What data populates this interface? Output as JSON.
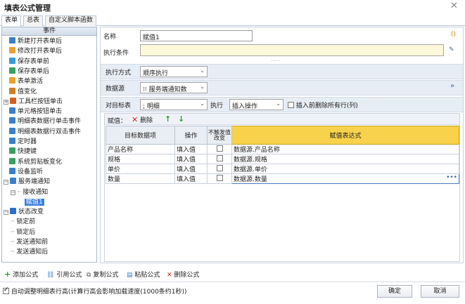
{
  "window": {
    "title": "填表公式管理"
  },
  "tabs": [
    "表单",
    "总表",
    "自定义脚本函数"
  ],
  "sidebar": {
    "header": "事件",
    "items": [
      {
        "label": "新建打开表单后",
        "icon": "user-icon",
        "color": "#3a7fc8"
      },
      {
        "label": "修改打开表单后",
        "icon": "folder-icon",
        "color": "#e8a030"
      },
      {
        "label": "保存表单前",
        "icon": "doc-icon",
        "color": "#3a9ad8"
      },
      {
        "label": "保存表单后",
        "icon": "doc-check-icon",
        "color": "#3aa060"
      },
      {
        "label": "表单激活",
        "icon": "folder-icon",
        "color": "#e8a030"
      },
      {
        "label": "值变化",
        "icon": "value-icon",
        "color": "#d08020"
      },
      {
        "label": "工具栏按钮单击",
        "icon": "tools-icon",
        "color": "#d06020"
      },
      {
        "label": "单元格按钮单击",
        "icon": "dots-icon",
        "color": "#3a7fc8"
      },
      {
        "label": "明细表数据行单击事件",
        "icon": "circle-icon",
        "color": "#3a7fc8"
      },
      {
        "label": "明细表数据行双击事件",
        "icon": "circle-icon",
        "color": "#3a7fc8"
      },
      {
        "label": "定时器",
        "icon": "timer-icon",
        "color": "#3a7fc8"
      },
      {
        "label": "快捷键",
        "icon": "share-icon",
        "color": "#3aa060"
      },
      {
        "label": "系统剪贴板变化",
        "icon": "scissors-icon",
        "color": "#3aa060"
      },
      {
        "label": "设备监听",
        "icon": "device-icon",
        "color": "#3a7fc8"
      },
      {
        "label": "服务端通知",
        "icon": "service-icon",
        "color": "#3a7fc8"
      },
      {
        "label": "接收通知",
        "icon": "",
        "color": ""
      },
      {
        "label": "赋值1",
        "icon": "",
        "color": ""
      },
      {
        "label": "状态改变",
        "icon": "status-icon",
        "color": "#2a70c8"
      },
      {
        "label": "锁定前",
        "icon": "",
        "color": ""
      },
      {
        "label": "锁定后",
        "icon": "",
        "color": ""
      },
      {
        "label": "发送通知前",
        "icon": "",
        "color": ""
      },
      {
        "label": "发送通知后",
        "icon": "",
        "color": ""
      }
    ]
  },
  "form": {
    "name_label": "名称",
    "name_value": "赋值1",
    "paren": "()",
    "condition_label": "执行条件",
    "mode_label": "执行方式",
    "mode_value": "顺序执行",
    "source_label": "数据源",
    "source_value": "⁝⁝ 服务端通知数",
    "target_label": "对目标表",
    "target_value": "; 明细",
    "exec_label": "执行",
    "exec_value": "插入操作",
    "clear_label": "插入前删除所有行(列)"
  },
  "grid": {
    "title": "赋值：",
    "delete_label": "删除",
    "headers": [
      "目标数据项",
      "操作",
      "不触发值改变",
      "赋值表达式"
    ],
    "rows": [
      {
        "target": "产品名称",
        "op": "填入值",
        "expr": "数据源.产品名称"
      },
      {
        "target": "规格",
        "op": "填入值",
        "expr": "数据源.规格"
      },
      {
        "target": "单价",
        "op": "填入值",
        "expr": "数据源.单价"
      },
      {
        "target": "数量",
        "op": "填入值",
        "expr": "数据源.数量"
      }
    ]
  },
  "bottom": {
    "add": "添加公式",
    "ref": "引用公式",
    "copy": "复制公式",
    "paste": "粘贴公式",
    "delete": "删除公式",
    "auto_label": "自动调整明细表行高(计算行高会影响加载速度(1000条约1秒))",
    "ok": "确定",
    "cancel": "取消"
  }
}
